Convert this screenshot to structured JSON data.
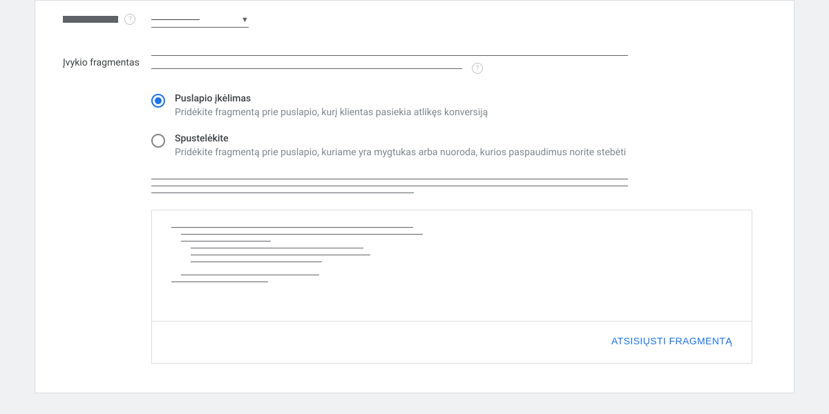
{
  "topField": {
    "label_redacted_width": 80
  },
  "section": {
    "label": "Įvykio fragmentas"
  },
  "radios": {
    "option1": {
      "title": "Puslapio įkėlimas",
      "desc": "Pridėkite fragmentą prie puslapio, kurį klientas pasiekia atlikęs konversiją"
    },
    "option2": {
      "title": "Spustelėkite",
      "desc": "Pridėkite fragmentą prie puslapio, kuriame yra mygtukas arba nuoroda, kurios paspaudimus norite stebėti"
    }
  },
  "actions": {
    "download": "ATSISIŲSTI FRAGMENTĄ"
  }
}
